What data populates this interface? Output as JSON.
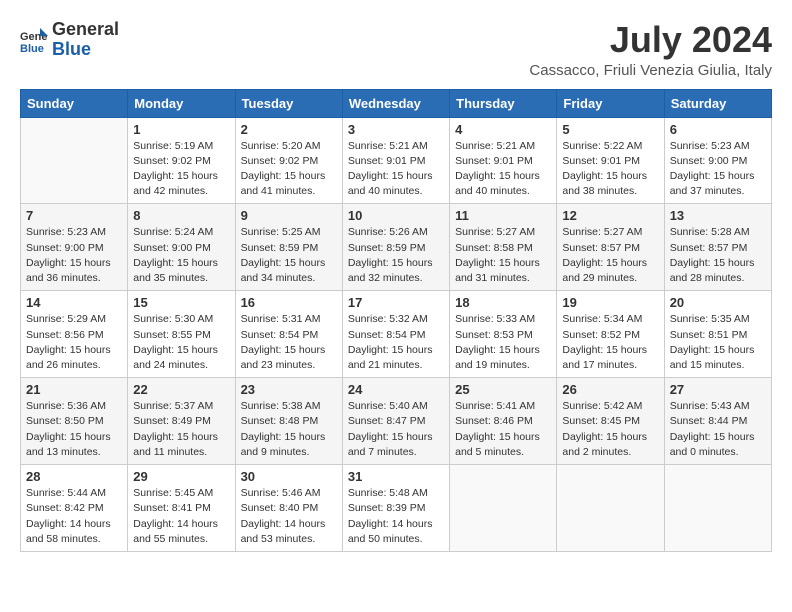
{
  "header": {
    "logo_general": "General",
    "logo_blue": "Blue",
    "month_title": "July 2024",
    "location": "Cassacco, Friuli Venezia Giulia, Italy"
  },
  "days_of_week": [
    "Sunday",
    "Monday",
    "Tuesday",
    "Wednesday",
    "Thursday",
    "Friday",
    "Saturday"
  ],
  "weeks": [
    [
      {
        "day": "",
        "info": ""
      },
      {
        "day": "1",
        "info": "Sunrise: 5:19 AM\nSunset: 9:02 PM\nDaylight: 15 hours\nand 42 minutes."
      },
      {
        "day": "2",
        "info": "Sunrise: 5:20 AM\nSunset: 9:02 PM\nDaylight: 15 hours\nand 41 minutes."
      },
      {
        "day": "3",
        "info": "Sunrise: 5:21 AM\nSunset: 9:01 PM\nDaylight: 15 hours\nand 40 minutes."
      },
      {
        "day": "4",
        "info": "Sunrise: 5:21 AM\nSunset: 9:01 PM\nDaylight: 15 hours\nand 40 minutes."
      },
      {
        "day": "5",
        "info": "Sunrise: 5:22 AM\nSunset: 9:01 PM\nDaylight: 15 hours\nand 38 minutes."
      },
      {
        "day": "6",
        "info": "Sunrise: 5:23 AM\nSunset: 9:00 PM\nDaylight: 15 hours\nand 37 minutes."
      }
    ],
    [
      {
        "day": "7",
        "info": "Sunrise: 5:23 AM\nSunset: 9:00 PM\nDaylight: 15 hours\nand 36 minutes."
      },
      {
        "day": "8",
        "info": "Sunrise: 5:24 AM\nSunset: 9:00 PM\nDaylight: 15 hours\nand 35 minutes."
      },
      {
        "day": "9",
        "info": "Sunrise: 5:25 AM\nSunset: 8:59 PM\nDaylight: 15 hours\nand 34 minutes."
      },
      {
        "day": "10",
        "info": "Sunrise: 5:26 AM\nSunset: 8:59 PM\nDaylight: 15 hours\nand 32 minutes."
      },
      {
        "day": "11",
        "info": "Sunrise: 5:27 AM\nSunset: 8:58 PM\nDaylight: 15 hours\nand 31 minutes."
      },
      {
        "day": "12",
        "info": "Sunrise: 5:27 AM\nSunset: 8:57 PM\nDaylight: 15 hours\nand 29 minutes."
      },
      {
        "day": "13",
        "info": "Sunrise: 5:28 AM\nSunset: 8:57 PM\nDaylight: 15 hours\nand 28 minutes."
      }
    ],
    [
      {
        "day": "14",
        "info": "Sunrise: 5:29 AM\nSunset: 8:56 PM\nDaylight: 15 hours\nand 26 minutes."
      },
      {
        "day": "15",
        "info": "Sunrise: 5:30 AM\nSunset: 8:55 PM\nDaylight: 15 hours\nand 24 minutes."
      },
      {
        "day": "16",
        "info": "Sunrise: 5:31 AM\nSunset: 8:54 PM\nDaylight: 15 hours\nand 23 minutes."
      },
      {
        "day": "17",
        "info": "Sunrise: 5:32 AM\nSunset: 8:54 PM\nDaylight: 15 hours\nand 21 minutes."
      },
      {
        "day": "18",
        "info": "Sunrise: 5:33 AM\nSunset: 8:53 PM\nDaylight: 15 hours\nand 19 minutes."
      },
      {
        "day": "19",
        "info": "Sunrise: 5:34 AM\nSunset: 8:52 PM\nDaylight: 15 hours\nand 17 minutes."
      },
      {
        "day": "20",
        "info": "Sunrise: 5:35 AM\nSunset: 8:51 PM\nDaylight: 15 hours\nand 15 minutes."
      }
    ],
    [
      {
        "day": "21",
        "info": "Sunrise: 5:36 AM\nSunset: 8:50 PM\nDaylight: 15 hours\nand 13 minutes."
      },
      {
        "day": "22",
        "info": "Sunrise: 5:37 AM\nSunset: 8:49 PM\nDaylight: 15 hours\nand 11 minutes."
      },
      {
        "day": "23",
        "info": "Sunrise: 5:38 AM\nSunset: 8:48 PM\nDaylight: 15 hours\nand 9 minutes."
      },
      {
        "day": "24",
        "info": "Sunrise: 5:40 AM\nSunset: 8:47 PM\nDaylight: 15 hours\nand 7 minutes."
      },
      {
        "day": "25",
        "info": "Sunrise: 5:41 AM\nSunset: 8:46 PM\nDaylight: 15 hours\nand 5 minutes."
      },
      {
        "day": "26",
        "info": "Sunrise: 5:42 AM\nSunset: 8:45 PM\nDaylight: 15 hours\nand 2 minutes."
      },
      {
        "day": "27",
        "info": "Sunrise: 5:43 AM\nSunset: 8:44 PM\nDaylight: 15 hours\nand 0 minutes."
      }
    ],
    [
      {
        "day": "28",
        "info": "Sunrise: 5:44 AM\nSunset: 8:42 PM\nDaylight: 14 hours\nand 58 minutes."
      },
      {
        "day": "29",
        "info": "Sunrise: 5:45 AM\nSunset: 8:41 PM\nDaylight: 14 hours\nand 55 minutes."
      },
      {
        "day": "30",
        "info": "Sunrise: 5:46 AM\nSunset: 8:40 PM\nDaylight: 14 hours\nand 53 minutes."
      },
      {
        "day": "31",
        "info": "Sunrise: 5:48 AM\nSunset: 8:39 PM\nDaylight: 14 hours\nand 50 minutes."
      },
      {
        "day": "",
        "info": ""
      },
      {
        "day": "",
        "info": ""
      },
      {
        "day": "",
        "info": ""
      }
    ]
  ]
}
